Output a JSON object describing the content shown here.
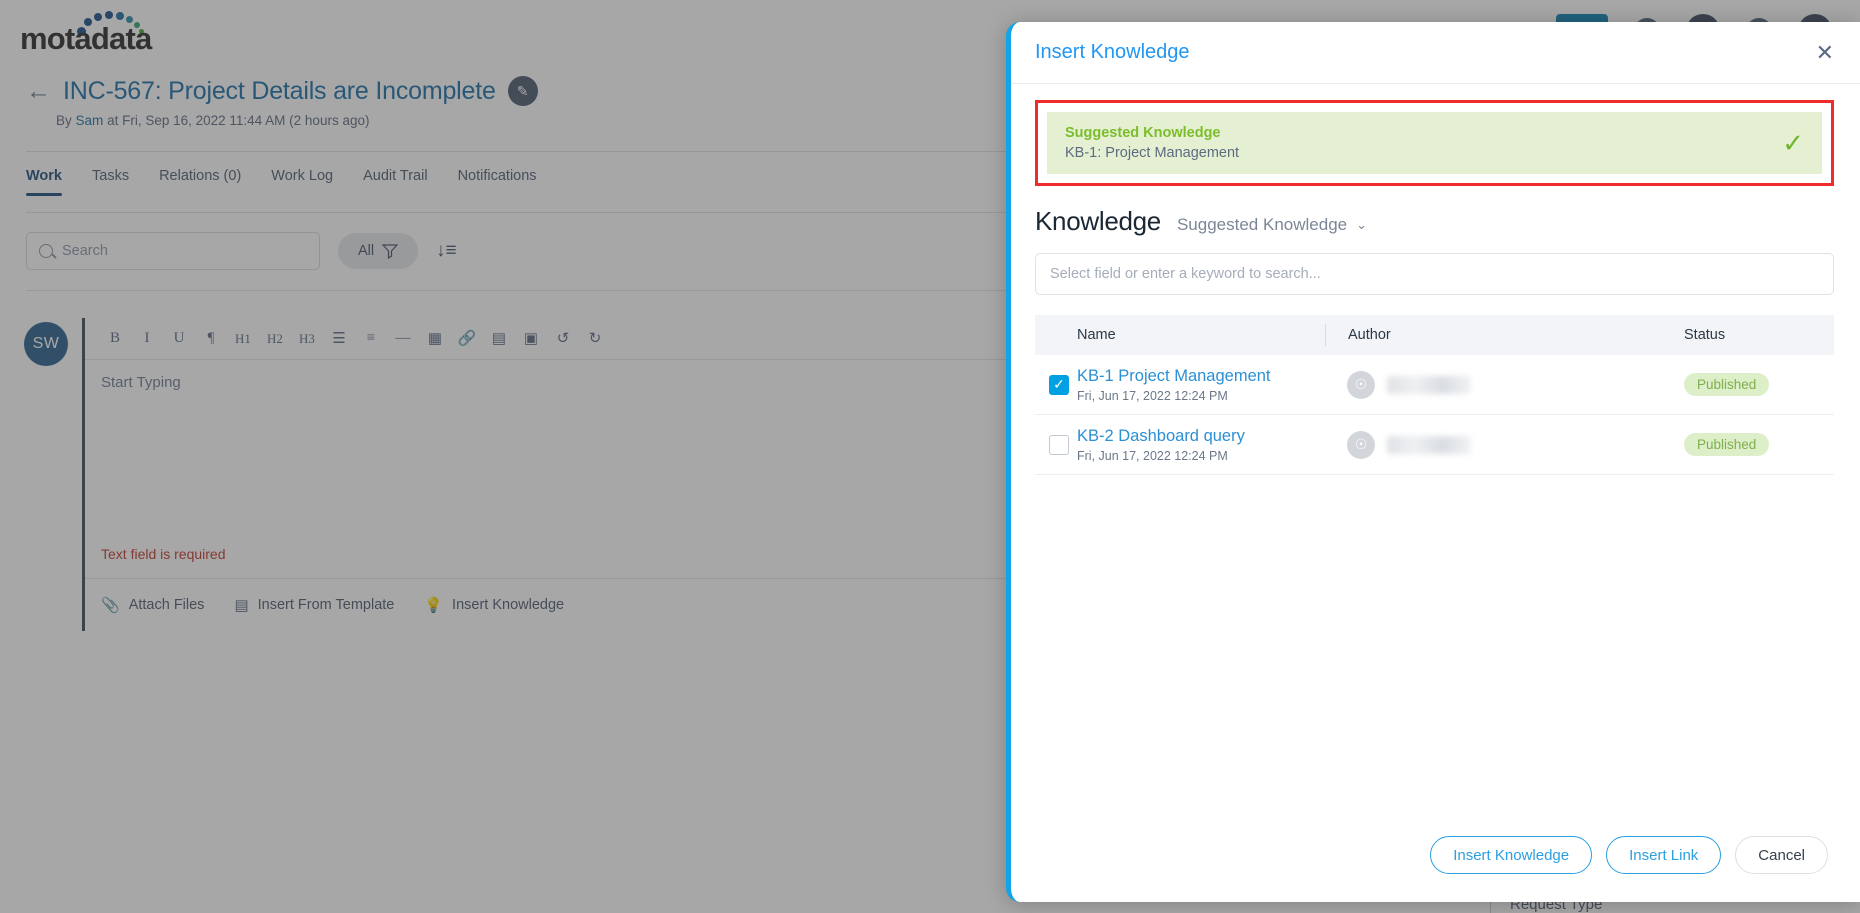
{
  "topbar": {
    "logo_text": "motadata",
    "logo_icon": "motadata-dots-logo",
    "action_label": "",
    "icons": [
      "bell-icon",
      "avatar-icon",
      "apps-icon",
      "help-icon"
    ]
  },
  "ticket": {
    "back_icon": "back-arrow-icon",
    "title": "INC-567: Project Details are Incomplete",
    "edit_icon": "pencil-icon",
    "meta_prefix": "By",
    "meta_author": "Sam",
    "meta_rest": "at Fri, Sep 16, 2022 11:44 AM (2 hours ago)"
  },
  "tabs": [
    {
      "label": "Work",
      "active": true
    },
    {
      "label": "Tasks",
      "active": false
    },
    {
      "label": "Relations (0)",
      "active": false
    },
    {
      "label": "Work Log",
      "active": false
    },
    {
      "label": "Audit Trail",
      "active": false
    },
    {
      "label": "Notifications",
      "active": false
    }
  ],
  "toolbar_row": {
    "search_placeholder": "Search",
    "search_icon": "search-icon",
    "filter_label": "All",
    "filter_icon": "funnel-icon",
    "sort_icon": "sort-descending-icon"
  },
  "editor": {
    "avatar_initials": "SW",
    "format_buttons": [
      "B",
      "I",
      "U",
      "¶",
      "H1",
      "H2",
      "H3",
      "☰",
      "≡",
      "—",
      "▦",
      "🔗",
      "▤",
      "▣",
      "↺",
      "↻"
    ],
    "placeholder": "Start Typing",
    "error_text": "Text field is required",
    "actions": [
      {
        "label": "Attach Files",
        "icon": "paperclip-icon"
      },
      {
        "label": "Insert From Template",
        "icon": "template-icon"
      },
      {
        "label": "Insert Knowledge",
        "icon": "lightbulb-icon"
      }
    ]
  },
  "page_bottom": {
    "request_type_label": "Request Type"
  },
  "modal": {
    "title": "Insert Knowledge",
    "close_icon": "close-icon",
    "suggested": {
      "title": "Suggested Knowledge",
      "subtitle": "KB-1: Project Management",
      "check_icon": "check-icon",
      "highlight_color": "#ef2b2b",
      "bg_color": "#e5f0d3"
    },
    "section": {
      "heading": "Knowledge",
      "selector_value": "Suggested Knowledge",
      "selector_icon": "chevron-down-icon"
    },
    "search_placeholder": "Select field or enter a keyword to search...",
    "table": {
      "columns": [
        "Name",
        "Author",
        "Status"
      ],
      "rows": [
        {
          "checked": true,
          "name": "KB-1 Project Management",
          "date": "Fri, Jun 17, 2022 12:24 PM",
          "author": "",
          "author_icon": "person-icon",
          "status": "Published"
        },
        {
          "checked": false,
          "name": "KB-2 Dashboard query",
          "date": "Fri, Jun 17, 2022 12:24 PM",
          "author": "",
          "author_icon": "person-icon",
          "status": "Published"
        }
      ]
    },
    "footer": {
      "insert_knowledge": "Insert Knowledge",
      "insert_link": "Insert Link",
      "cancel": "Cancel"
    }
  }
}
